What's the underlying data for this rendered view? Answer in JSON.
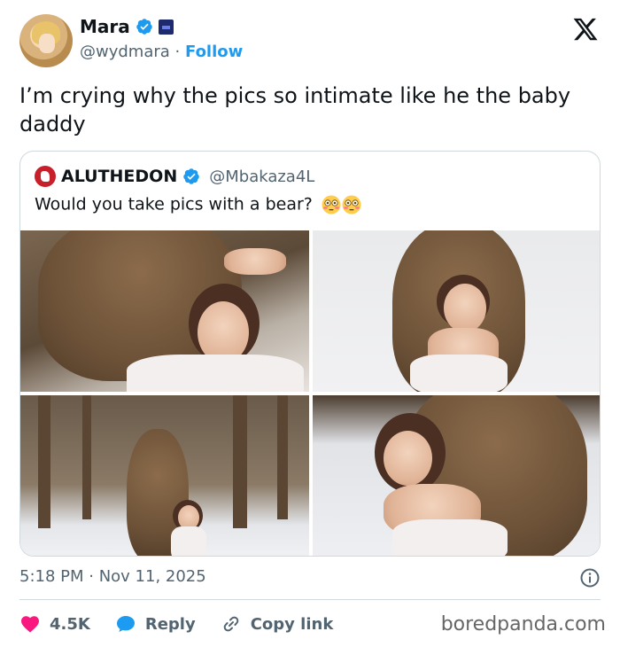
{
  "author": {
    "display_name": "Mara",
    "handle": "@wydmara",
    "separator": "·",
    "follow_label": "Follow"
  },
  "tweet": {
    "text": "I’m crying why the pics so intimate like he the baby daddy"
  },
  "quoted": {
    "display_name": "ALUTHEDON",
    "handle": "@Mbakaza4L",
    "text": "Would you take pics with a bear?"
  },
  "photos": [
    {
      "alt": "woman embraced by bear in forest"
    },
    {
      "alt": "woman in white with bear in snow"
    },
    {
      "alt": "standing bear and woman in snowy forest"
    },
    {
      "alt": "woman leaning on bear in snow"
    }
  ],
  "meta": {
    "timestamp": "5:18 PM · Nov 11, 2025"
  },
  "actions": {
    "likes": "4.5K",
    "reply_label": "Reply",
    "copy_link_label": "Copy link"
  },
  "watermark": "boredpanda.com",
  "colors": {
    "accent": "#1d9bf0",
    "like": "#f91880",
    "text": "#0f1419",
    "muted": "#536471"
  }
}
